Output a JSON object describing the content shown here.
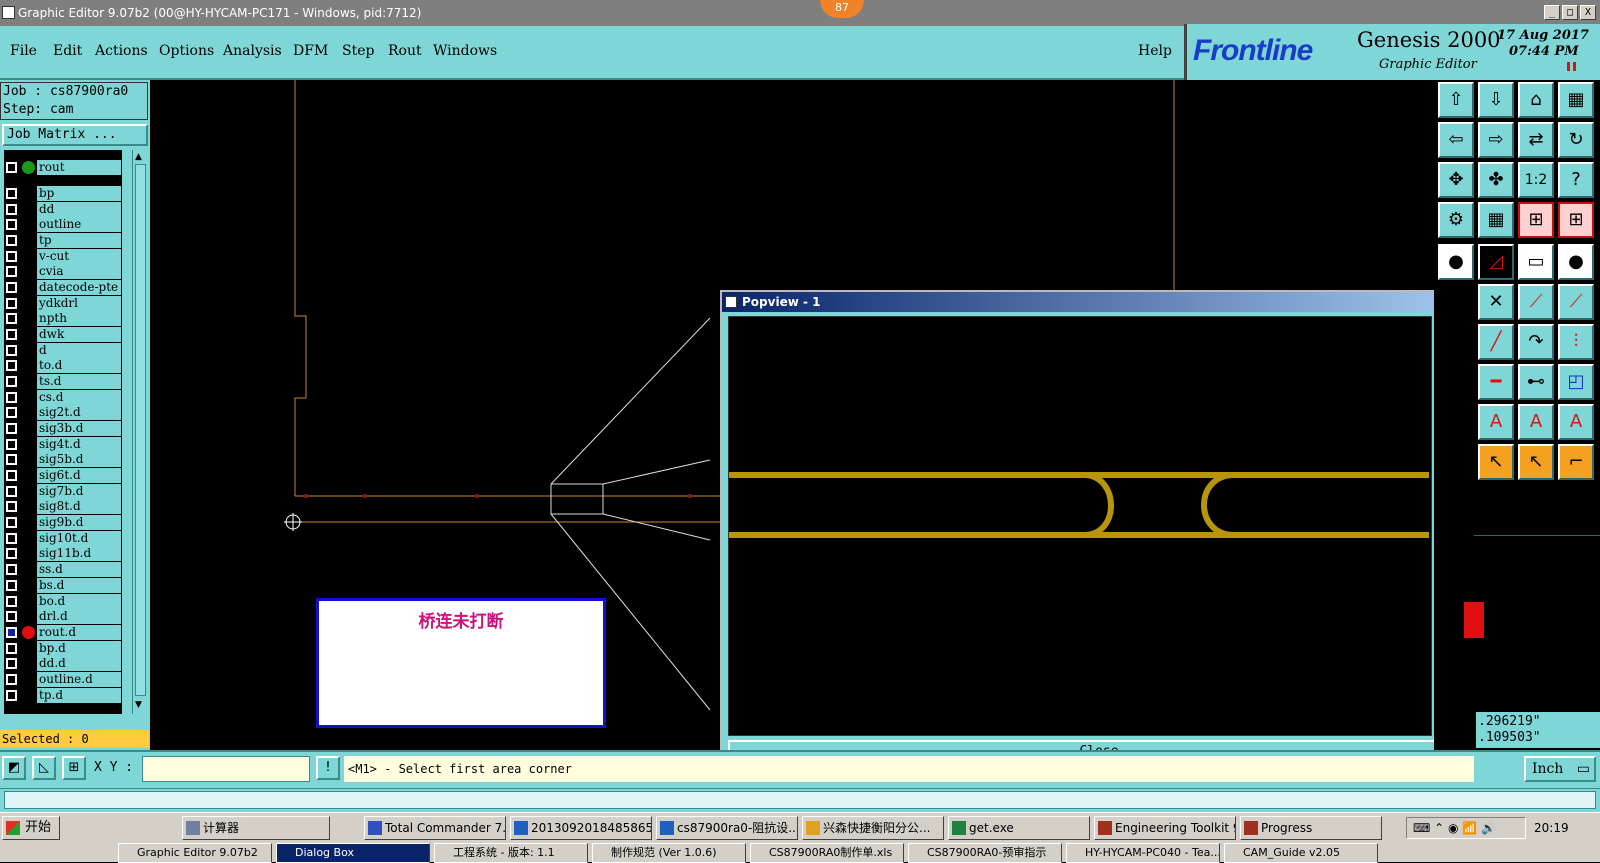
{
  "window": {
    "title": "Graphic Editor 9.07b2 (00@HY-HYCAM-PC171 - Windows, pid:7712)",
    "badge": "87",
    "min_label": "_",
    "max_label": "□",
    "close_label": "X"
  },
  "menu": {
    "items": [
      "File",
      "Edit",
      "Actions",
      "Options",
      "Analysis",
      "DFM",
      "Step",
      "Rout",
      "Windows"
    ],
    "help": "Help"
  },
  "branding": {
    "logo": "Frontline",
    "product": "Genesis 2000",
    "subtitle": "Graphic Editor",
    "date": "17 Aug 2017",
    "time": "07:44 PM",
    "logo_color": "#1a3cc8"
  },
  "job": {
    "job_line": "Job : cs87900ra0",
    "step_line": "Step: cam",
    "matrix_button": "Job Matrix ..."
  },
  "layers": [
    {
      "name": "rout",
      "dot": "#1a9a1a",
      "checked": false
    },
    {
      "name": "bp",
      "dot": "",
      "checked": false
    },
    {
      "name": "dd",
      "dot": "",
      "checked": false
    },
    {
      "name": "outline",
      "dot": "",
      "checked": false
    },
    {
      "name": "tp",
      "dot": "",
      "checked": false
    },
    {
      "name": "v-cut",
      "dot": "",
      "checked": false
    },
    {
      "name": "cvia",
      "dot": "",
      "checked": false
    },
    {
      "name": "datecode-pte",
      "dot": "",
      "checked": false
    },
    {
      "name": "ydkdrl",
      "dot": "",
      "checked": false
    },
    {
      "name": "npth",
      "dot": "",
      "checked": false
    },
    {
      "name": "dwk",
      "dot": "",
      "checked": false
    },
    {
      "name": "d",
      "dot": "",
      "checked": false
    },
    {
      "name": "to.d",
      "dot": "",
      "checked": false
    },
    {
      "name": "ts.d",
      "dot": "",
      "checked": false
    },
    {
      "name": "cs.d",
      "dot": "",
      "checked": false
    },
    {
      "name": "sig2t.d",
      "dot": "",
      "checked": false
    },
    {
      "name": "sig3b.d",
      "dot": "",
      "checked": false
    },
    {
      "name": "sig4t.d",
      "dot": "",
      "checked": false
    },
    {
      "name": "sig5b.d",
      "dot": "",
      "checked": false
    },
    {
      "name": "sig6t.d",
      "dot": "",
      "checked": false
    },
    {
      "name": "sig7b.d",
      "dot": "",
      "checked": false
    },
    {
      "name": "sig8t.d",
      "dot": "",
      "checked": false
    },
    {
      "name": "sig9b.d",
      "dot": "",
      "checked": false
    },
    {
      "name": "sig10t.d",
      "dot": "",
      "checked": false
    },
    {
      "name": "sig11b.d",
      "dot": "",
      "checked": false
    },
    {
      "name": "ss.d",
      "dot": "",
      "checked": false
    },
    {
      "name": "bs.d",
      "dot": "",
      "checked": false
    },
    {
      "name": "bo.d",
      "dot": "",
      "checked": false
    },
    {
      "name": "drl.d",
      "dot": "",
      "checked": false
    },
    {
      "name": "rout.d",
      "dot": "#e01010",
      "checked": true
    },
    {
      "name": "bp.d",
      "dot": "",
      "checked": false
    },
    {
      "name": "dd.d",
      "dot": "",
      "checked": false
    },
    {
      "name": "outline.d",
      "dot": "",
      "checked": false
    },
    {
      "name": "tp.d",
      "dot": "",
      "checked": false
    }
  ],
  "status": {
    "selected": "Selected : 0",
    "xy_label": "X Y :",
    "xy_value": "",
    "prompt": "<M1> - Select first area corner",
    "unit": "Inch"
  },
  "coords": {
    "x": ".296219\"",
    "y": ".109503\""
  },
  "annotation": {
    "text": "桥连未打断",
    "text_color": "#d0107a",
    "border_color": "#1010d0"
  },
  "popview": {
    "title": "Popview - 1",
    "close_button": "Close",
    "trace_color": "#b8960c"
  },
  "taskbar": {
    "start": "开始",
    "items": [
      "计算器",
      "Total Commander 7.0...",
      "20130920184858655...",
      "cs87900ra0-阻抗设...",
      "兴森快捷衡阳分公...",
      "get.exe",
      "Engineering Toolkit 9....",
      "Progress"
    ],
    "row2": [
      "Graphic Editor 9.07b2",
      "Dialog Box",
      "工程系统 - 版本: 1.1",
      "制作规范 (Ver 1.0.6)",
      "CS87900RA0制作单.xls",
      "CS87900RA0-预审指示",
      "HY-HYCAM-PC040 - Tea...",
      "CAM_Guide v2.05"
    ],
    "clock": "20:19"
  }
}
